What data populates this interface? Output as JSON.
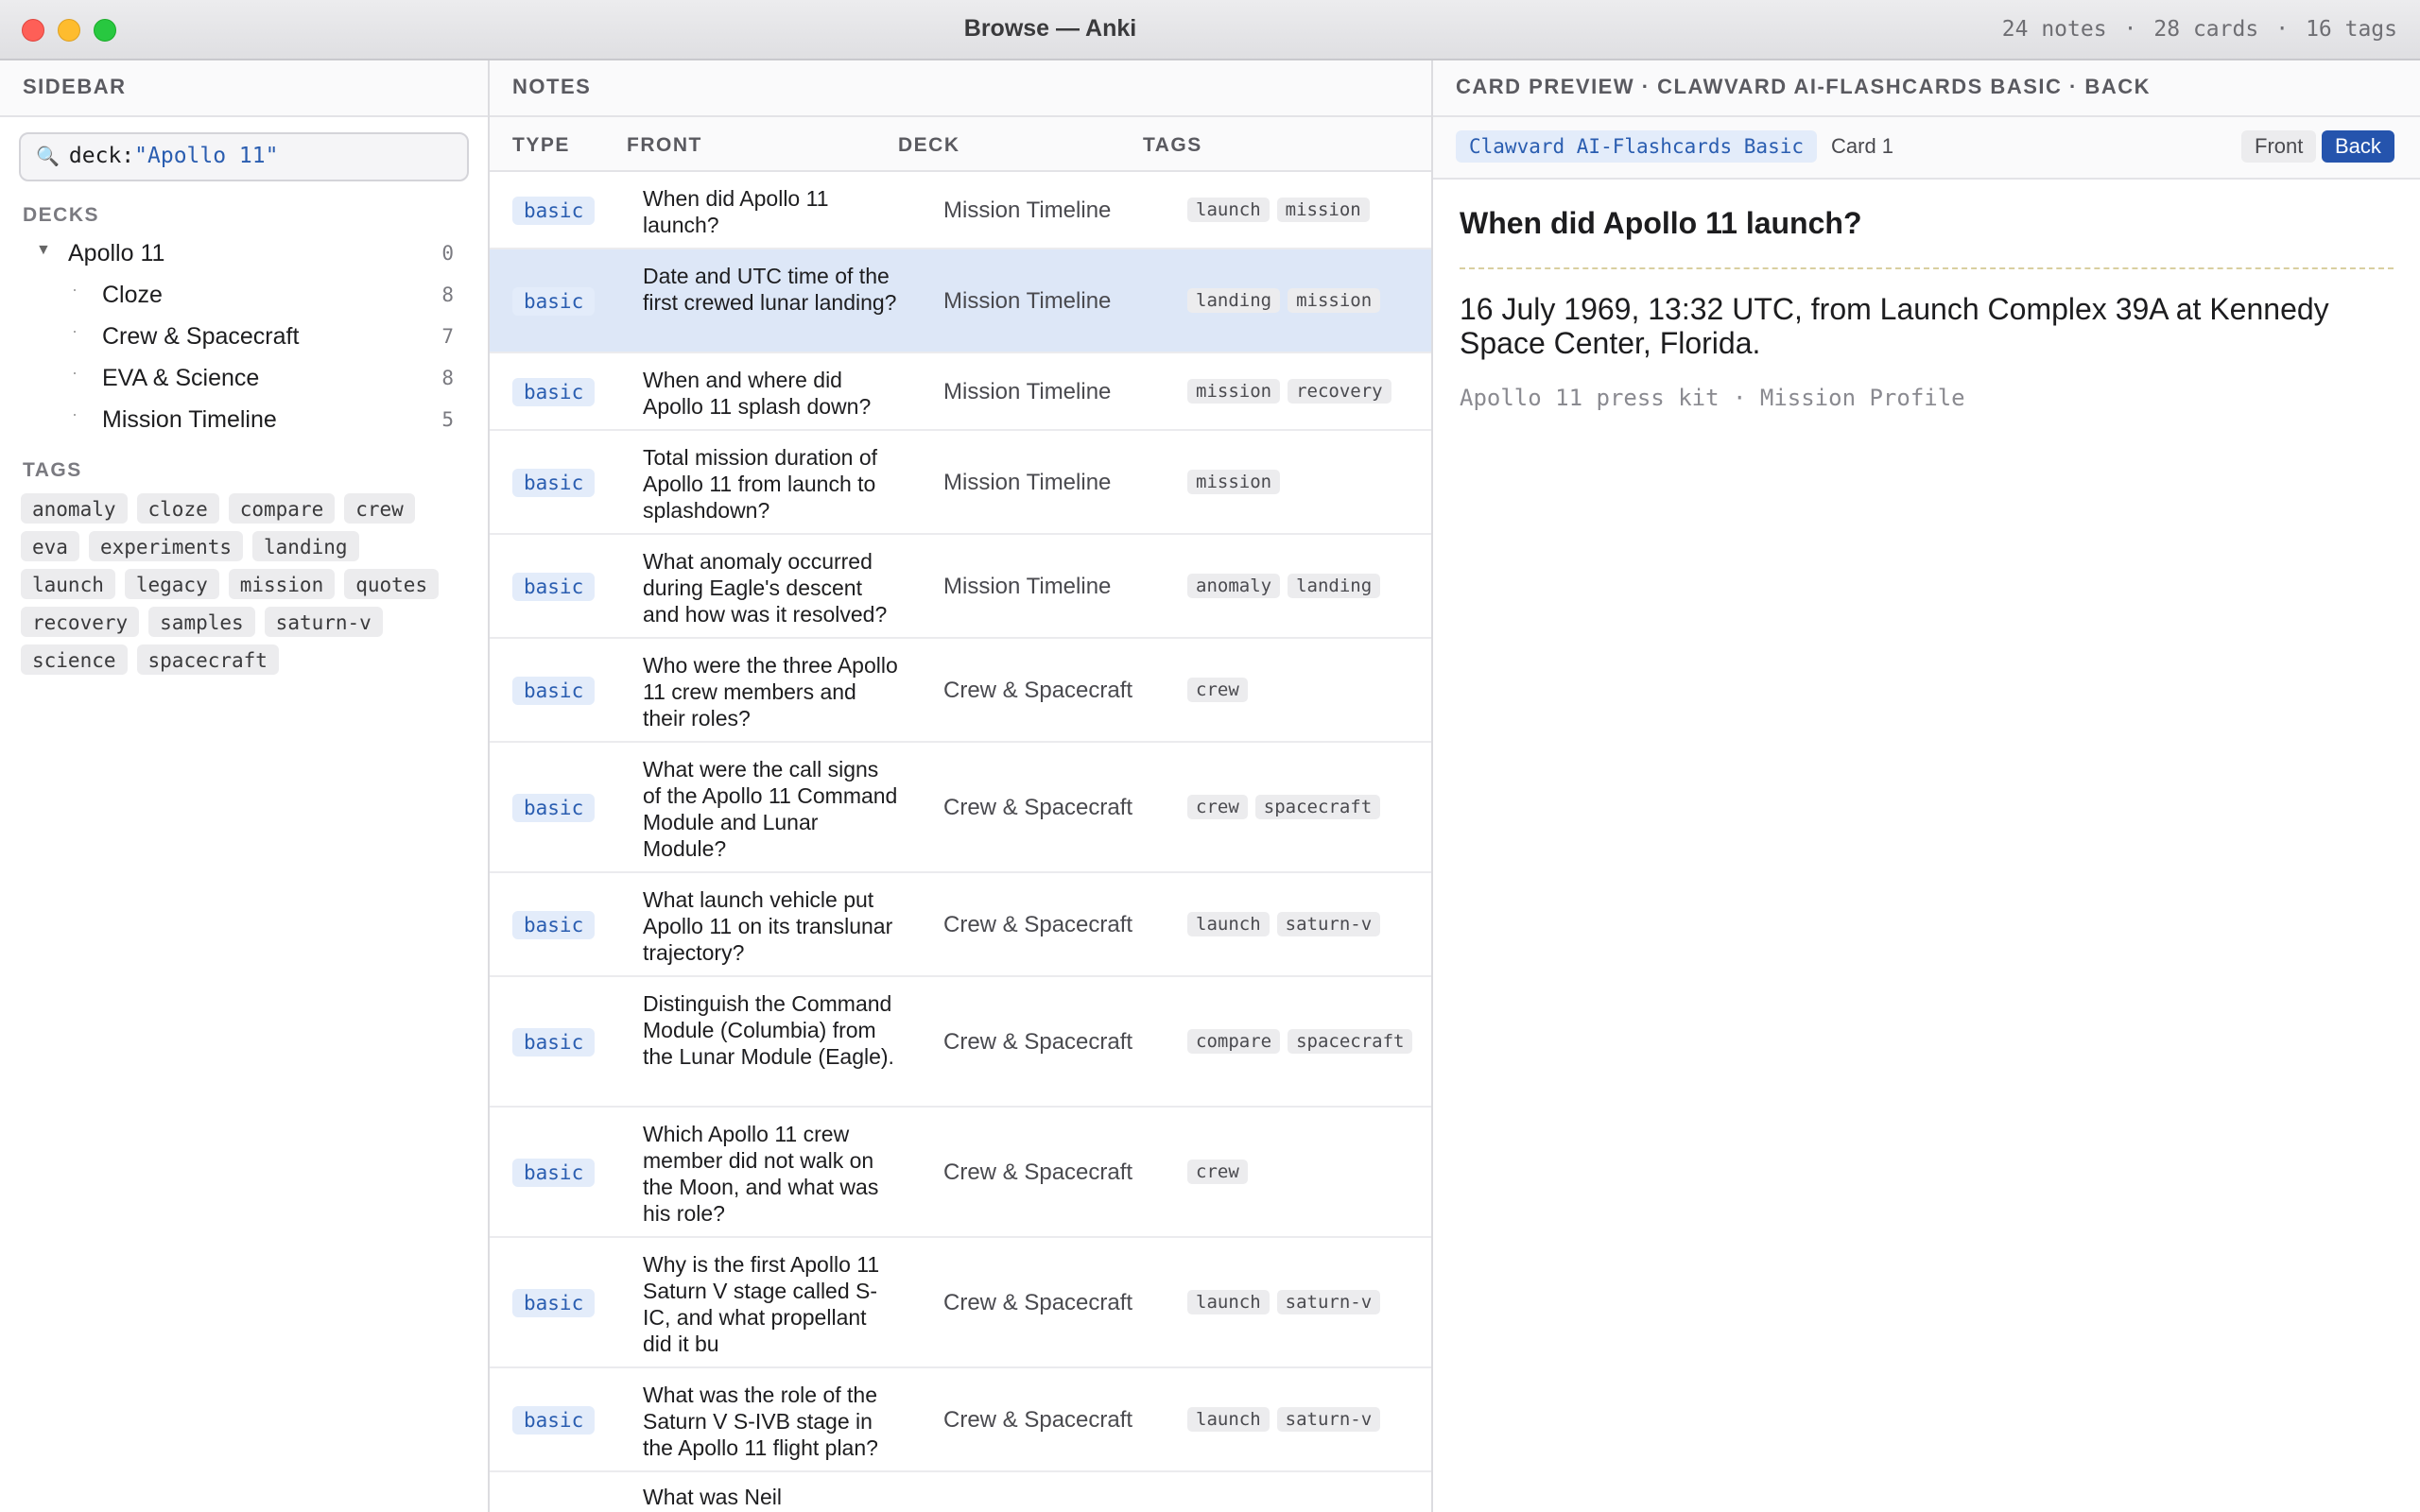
{
  "window": {
    "title": "Browse — Anki",
    "stats": {
      "notes": "24 notes",
      "cards": "28 cards",
      "tags": "16 tags",
      "separator": "·"
    }
  },
  "sidebar": {
    "header": "SIDEBAR",
    "search": {
      "key": "deck:",
      "query": "\"Apollo 11\""
    },
    "decks_label": "DECKS",
    "decks": [
      {
        "name": "Apollo 11",
        "count": "0",
        "expanded": true
      },
      {
        "name": "Cloze",
        "count": "8"
      },
      {
        "name": "Crew & Spacecraft",
        "count": "7"
      },
      {
        "name": "EVA & Science",
        "count": "8"
      },
      {
        "name": "Mission Timeline",
        "count": "5"
      }
    ],
    "tags_label": "TAGS",
    "tags": [
      "anomaly",
      "cloze",
      "compare",
      "crew",
      "eva",
      "experiments",
      "landing",
      "launch",
      "legacy",
      "mission",
      "quotes",
      "recovery",
      "samples",
      "saturn-v",
      "science",
      "spacecraft"
    ]
  },
  "notes": {
    "header": "NOTES",
    "columns": [
      "TYPE",
      "FRONT",
      "DECK",
      "TAGS"
    ],
    "rows": [
      {
        "type": "basic",
        "front": "When did Apollo 11 launch?",
        "deck": "Mission Timeline",
        "tags": [
          "launch",
          "mission"
        ]
      },
      {
        "type": "basic",
        "front": "Date and UTC time of the first crewed lunar landing?",
        "deck": "Mission Timeline",
        "tags": [
          "landing",
          "mission"
        ],
        "selected": true
      },
      {
        "type": "basic",
        "front": "When and where did Apollo 11 splash down?",
        "deck": "Mission Timeline",
        "tags": [
          "mission",
          "recovery"
        ]
      },
      {
        "type": "basic",
        "front": "Total mission duration of Apollo 11 from launch to splashdown?",
        "deck": "Mission Timeline",
        "tags": [
          "mission"
        ]
      },
      {
        "type": "basic",
        "front": "What anomaly occurred during Eagle's descent and how was it resolved?",
        "deck": "Mission Timeline",
        "tags": [
          "anomaly",
          "landing"
        ]
      },
      {
        "type": "basic",
        "front": "Who were the three Apollo 11 crew members and their roles?",
        "deck": "Crew & Spacecraft",
        "tags": [
          "crew"
        ]
      },
      {
        "type": "basic",
        "front": "What were the call signs of the Apollo 11 Command Module and Lunar Module?",
        "deck": "Crew & Spacecraft",
        "tags": [
          "crew",
          "spacecraft"
        ]
      },
      {
        "type": "basic",
        "front": "What launch vehicle put Apollo 11 on its translunar trajectory?",
        "deck": "Crew & Spacecraft",
        "tags": [
          "launch",
          "saturn-v"
        ]
      },
      {
        "type": "basic",
        "front": "Distinguish the Command Module (Columbia) from the Lunar Module (Eagle).",
        "deck": "Crew & Spacecraft",
        "tags": [
          "compare",
          "spacecraft"
        ]
      },
      {
        "type": "basic",
        "front": "Which Apollo 11 crew member did not walk on the Moon, and what was his role?",
        "deck": "Crew & Spacecraft",
        "tags": [
          "crew"
        ]
      },
      {
        "type": "basic",
        "front": "Why is the first Apollo 11 Saturn V stage called S-IC, and what propellant did it bu",
        "deck": "Crew & Spacecraft",
        "tags": [
          "launch",
          "saturn-v"
        ]
      },
      {
        "type": "basic",
        "front": "What was the role of the Saturn V S-IVB stage in the Apollo 11 flight plan?",
        "deck": "Crew & Spacecraft",
        "tags": [
          "launch",
          "saturn-v"
        ]
      },
      {
        "type": "",
        "front": "What was Neil",
        "deck": "",
        "tags": []
      }
    ]
  },
  "preview": {
    "header": "CARD PREVIEW · CLAWVARD AI-FLASHCARDS BASIC · BACK",
    "note_type": "Clawvard AI-Flashcards Basic",
    "card": "Card 1",
    "front_btn": "Front",
    "back_btn": "Back",
    "question": "When did Apollo 11 launch?",
    "answer": "16 July 1969, 13:32 UTC, from Launch Complex 39A at Kennedy Space Center, Florida.",
    "source": "Apollo 11 press kit · Mission Profile"
  }
}
